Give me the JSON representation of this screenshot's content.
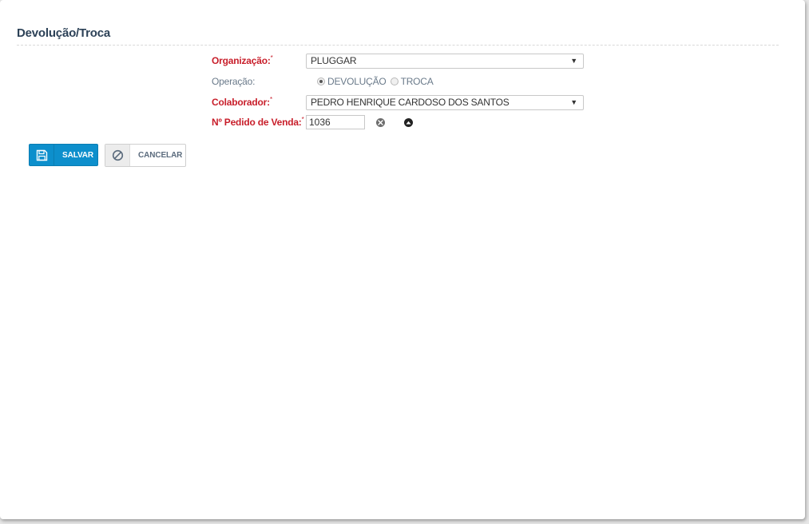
{
  "page": {
    "title": "Devolução/Troca"
  },
  "form": {
    "organizacao": {
      "label": "Organização:",
      "required_mark": "*",
      "value": "PLUGGAR"
    },
    "operacao": {
      "label": "Operação:",
      "options": [
        {
          "label": "DEVOLUÇÃO",
          "checked": true
        },
        {
          "label": "TROCA",
          "checked": false
        }
      ]
    },
    "colaborador": {
      "label": "Colaborador:",
      "required_mark": "*",
      "value": "PEDRO HENRIQUE CARDOSO DOS SANTOS"
    },
    "pedido": {
      "label": "Nº Pedido de Venda:",
      "required_mark": "*",
      "value": "1036"
    }
  },
  "actions": {
    "save_label": "SALVAR",
    "cancel_label": "CANCELAR"
  },
  "icons": {
    "caret": "caret-down-icon",
    "clear": "close-circle-icon",
    "collapse": "chevron-up-circle-icon",
    "save": "floppy-disk-icon",
    "cancel": "ban-icon"
  },
  "colors": {
    "title": "#2c4157",
    "required_label": "#c81e2a",
    "primary_button": "#0d8fcc",
    "muted_text": "#6a7a8a"
  }
}
